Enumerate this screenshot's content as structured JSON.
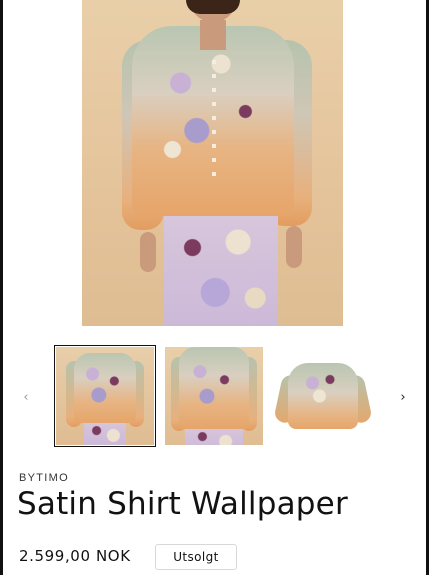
{
  "gallery": {
    "main_image_alt": "Satin Shirt Wallpaper",
    "prev_icon": "chevron-left-icon",
    "next_icon": "chevron-right-icon",
    "prev_glyph": "‹",
    "next_glyph": "›",
    "thumbnails": [
      {
        "label": "front-view",
        "active": true
      },
      {
        "label": "front-close-view",
        "active": false
      },
      {
        "label": "flat-lay-view",
        "active": false
      }
    ]
  },
  "product": {
    "vendor": "BYTIMO",
    "title": "Satin Shirt Wallpaper",
    "price": "2.599,00 NOK",
    "badge": "Utsolgt"
  },
  "colors": {
    "text": "#121212",
    "badge_border": "#d8d8d8",
    "background": "#ffffff"
  }
}
